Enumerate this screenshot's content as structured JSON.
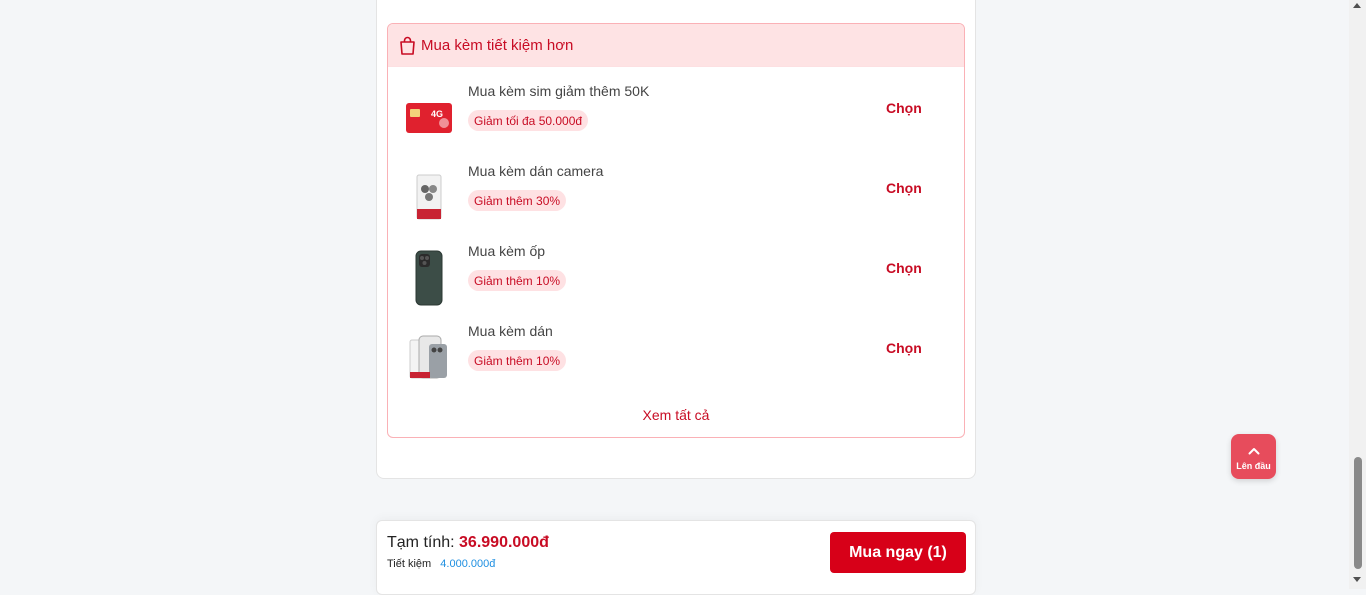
{
  "bundle": {
    "title": "Mua kèm tiết kiệm hơn",
    "icon": "shopping-bag-icon",
    "items": [
      {
        "name": "Mua kèm sim giảm thêm 50K",
        "badge": "Giảm tối đa 50.000đ",
        "action": "Chọn",
        "thumb": "sim-card-4g-image"
      },
      {
        "name": "Mua kèm dán camera",
        "badge": "Giảm thêm 30%",
        "action": "Chọn",
        "thumb": "camera-protector-image"
      },
      {
        "name": "Mua kèm ốp",
        "badge": "Giảm thêm 10%",
        "action": "Chọn",
        "thumb": "phone-case-image"
      },
      {
        "name": "Mua kèm dán",
        "badge": "Giảm thêm 10%",
        "action": "Chọn",
        "thumb": "screen-protector-image"
      }
    ],
    "see_all": "Xem tất cả"
  },
  "to_top": {
    "label": "Lên đầu",
    "icon": "chevron-up-icon"
  },
  "checkout": {
    "subtotal_label": "Tạm tính:",
    "subtotal_value": "36.990.000đ",
    "savings_label": "Tiết kiệm",
    "savings_value": "4.000.000đ",
    "buy_label": "Mua ngay (1)"
  },
  "colors": {
    "accent": "#d70018",
    "accent_text": "#c80c24",
    "header_bg": "#fee3e4",
    "savings": "#1e8fe1"
  }
}
